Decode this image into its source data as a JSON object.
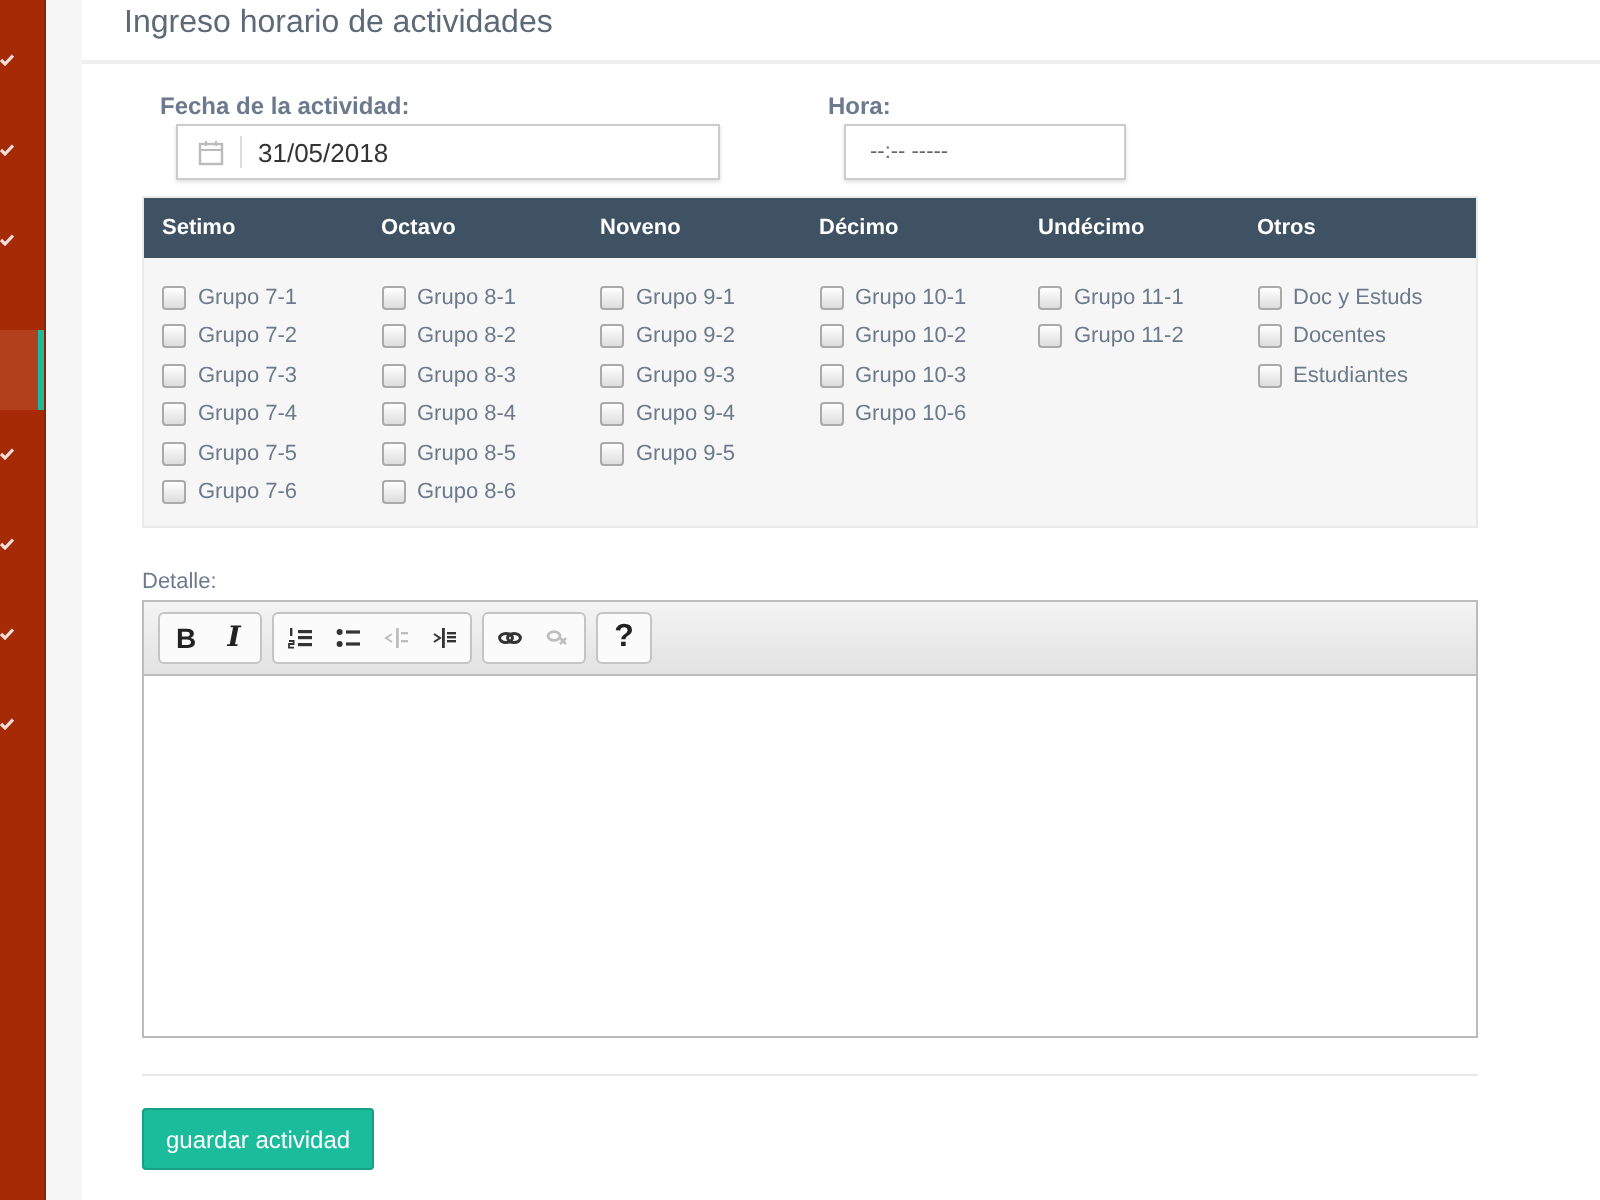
{
  "sidebar": {
    "items": [
      {
        "selected": false
      },
      {
        "selected": false
      },
      {
        "selected": false
      },
      {
        "selected": true
      },
      {
        "selected": false
      },
      {
        "selected": false
      },
      {
        "selected": false
      },
      {
        "selected": false
      }
    ]
  },
  "page_title": "Ingreso horario de actividades",
  "date_field": {
    "label": "Fecha de la actividad:",
    "value": "31/05/2018"
  },
  "time_field": {
    "label": "Hora:",
    "placeholder": "--:-- -----"
  },
  "groups": [
    {
      "heading": "Setimo",
      "options": [
        {
          "label": "Grupo 7-1",
          "checked": false
        },
        {
          "label": "Grupo 7-2",
          "checked": false
        },
        {
          "label": "Grupo 7-3",
          "checked": false
        },
        {
          "label": "Grupo 7-4",
          "checked": false
        },
        {
          "label": "Grupo 7-5",
          "checked": false
        },
        {
          "label": "Grupo 7-6",
          "checked": false
        }
      ]
    },
    {
      "heading": "Octavo",
      "options": [
        {
          "label": "Grupo 8-1",
          "checked": false
        },
        {
          "label": "Grupo 8-2",
          "checked": false
        },
        {
          "label": "Grupo 8-3",
          "checked": false
        },
        {
          "label": "Grupo 8-4",
          "checked": false
        },
        {
          "label": "Grupo 8-5",
          "checked": false
        },
        {
          "label": "Grupo 8-6",
          "checked": false
        }
      ]
    },
    {
      "heading": "Noveno",
      "options": [
        {
          "label": "Grupo 9-1",
          "checked": false
        },
        {
          "label": "Grupo 9-2",
          "checked": false
        },
        {
          "label": "Grupo 9-3",
          "checked": false
        },
        {
          "label": "Grupo 9-4",
          "checked": false
        },
        {
          "label": "Grupo 9-5",
          "checked": false
        }
      ]
    },
    {
      "heading": "Décimo",
      "options": [
        {
          "label": "Grupo 10-1",
          "checked": false
        },
        {
          "label": "Grupo 10-2",
          "checked": false
        },
        {
          "label": "Grupo 10-3",
          "checked": false
        },
        {
          "label": "Grupo 10-6",
          "checked": false
        }
      ]
    },
    {
      "heading": "Undécimo",
      "options": [
        {
          "label": "Grupo 11-1",
          "checked": false
        },
        {
          "label": "Grupo 11-2",
          "checked": false
        }
      ]
    },
    {
      "heading": "Otros",
      "options": [
        {
          "label": "Doc y Estuds",
          "checked": false
        },
        {
          "label": "Docentes",
          "checked": false
        },
        {
          "label": "Estudiantes",
          "checked": false
        }
      ]
    }
  ],
  "detail": {
    "label": "Detalle:",
    "toolbar": [
      [
        {
          "kind": "bold",
          "label": "B",
          "disabled": false
        },
        {
          "kind": "italic",
          "label": "I",
          "disabled": false
        }
      ],
      [
        {
          "kind": "ordered-list",
          "disabled": false
        },
        {
          "kind": "bullet-list",
          "disabled": false
        },
        {
          "kind": "outdent",
          "disabled": true
        },
        {
          "kind": "indent",
          "disabled": false
        }
      ],
      [
        {
          "kind": "link",
          "disabled": false
        },
        {
          "kind": "unlink",
          "disabled": true
        }
      ],
      [
        {
          "kind": "help",
          "label": "?",
          "disabled": false
        }
      ]
    ]
  },
  "save_button": "guardar actividad"
}
